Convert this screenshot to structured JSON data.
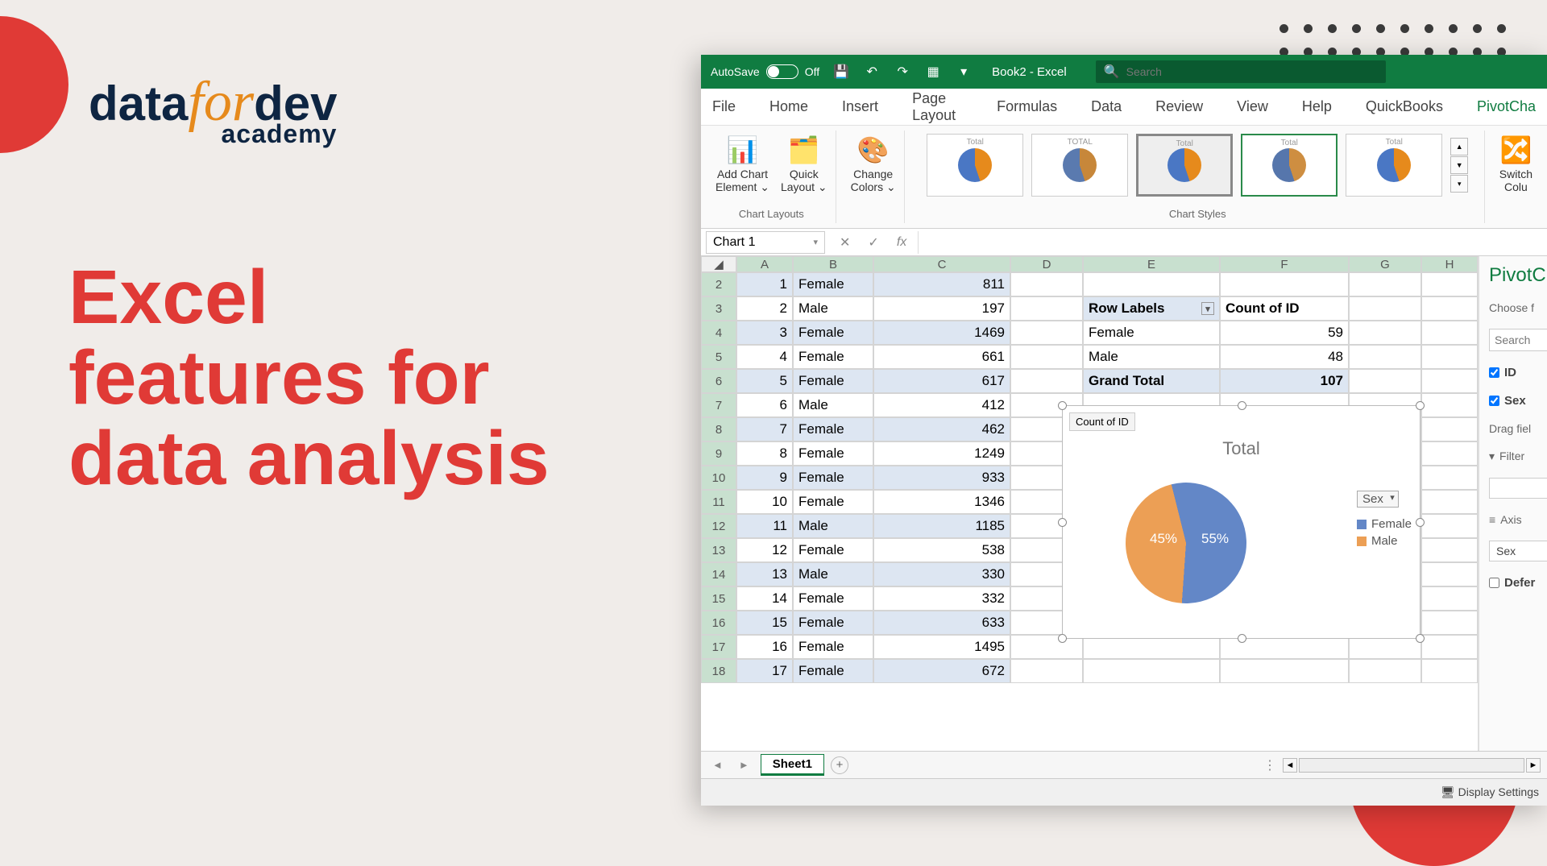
{
  "promo": {
    "logo_data": "data",
    "logo_for": "for",
    "logo_dev": "dev",
    "logo_academy": "academy",
    "headline_l1": "Excel",
    "headline_l2": "features for",
    "headline_l3": "data analysis"
  },
  "titlebar": {
    "autosave": "AutoSave",
    "autosave_state": "Off",
    "doc": "Book2  -  Excel",
    "search_placeholder": "Search"
  },
  "tabs": [
    "File",
    "Home",
    "Insert",
    "Page Layout",
    "Formulas",
    "Data",
    "Review",
    "View",
    "Help",
    "QuickBooks",
    "PivotCha"
  ],
  "ribbon": {
    "group1_label": "Chart Layouts",
    "btn_add_chart_l1": "Add Chart",
    "btn_add_chart_l2": "Element ⌄",
    "btn_quick_l1": "Quick",
    "btn_quick_l2": "Layout ⌄",
    "group2_btn_l1": "Change",
    "group2_btn_l2": "Colors ⌄",
    "group2_label": "Chart Styles",
    "group3_btn_l1": "Switch",
    "group3_btn_l2": "Colu"
  },
  "namebox": "Chart 1",
  "fx_label": "fx",
  "columns": [
    "A",
    "B",
    "C",
    "D",
    "E",
    "F",
    "G",
    "H"
  ],
  "rows": [
    {
      "n": 2,
      "a": 1,
      "b": "Female",
      "c": 811
    },
    {
      "n": 3,
      "a": 2,
      "b": "Male",
      "c": 197
    },
    {
      "n": 4,
      "a": 3,
      "b": "Female",
      "c": 1469
    },
    {
      "n": 5,
      "a": 4,
      "b": "Female",
      "c": 661
    },
    {
      "n": 6,
      "a": 5,
      "b": "Female",
      "c": 617
    },
    {
      "n": 7,
      "a": 6,
      "b": "Male",
      "c": 412
    },
    {
      "n": 8,
      "a": 7,
      "b": "Female",
      "c": 462
    },
    {
      "n": 9,
      "a": 8,
      "b": "Female",
      "c": 1249
    },
    {
      "n": 10,
      "a": 9,
      "b": "Female",
      "c": 933
    },
    {
      "n": 11,
      "a": 10,
      "b": "Female",
      "c": 1346
    },
    {
      "n": 12,
      "a": 11,
      "b": "Male",
      "c": 1185
    },
    {
      "n": 13,
      "a": 12,
      "b": "Female",
      "c": 538
    },
    {
      "n": 14,
      "a": 13,
      "b": "Male",
      "c": 330
    },
    {
      "n": 15,
      "a": 14,
      "b": "Female",
      "c": 332
    },
    {
      "n": 16,
      "a": 15,
      "b": "Female",
      "c": 633
    },
    {
      "n": 17,
      "a": 16,
      "b": "Female",
      "c": 1495
    },
    {
      "n": 18,
      "a": 17,
      "b": "Female",
      "c": 672
    }
  ],
  "pivot": {
    "row_labels": "Row Labels",
    "count_of_id": "Count of ID",
    "female": "Female",
    "female_n": 59,
    "male": "Male",
    "male_n": 48,
    "grand": "Grand Total",
    "grand_n": 107
  },
  "chart_data": {
    "type": "pie",
    "title": "Total",
    "button": "Count of ID",
    "legend_field": "Sex",
    "series": [
      {
        "name": "Female",
        "percent": 55,
        "color": "#6387c7"
      },
      {
        "name": "Male",
        "percent": 45,
        "color": "#ec9f55"
      }
    ],
    "pct_female": "55%",
    "pct_male": "45%"
  },
  "sheet_tab": "Sheet1",
  "statusbar": {
    "display_settings": "Display Settings"
  },
  "pane": {
    "title": "PivotC",
    "choose": "Choose f",
    "search": "Search",
    "field_id": "ID",
    "field_sex": "Sex",
    "drag": "Drag fiel",
    "filters": "Filter",
    "axis": "Axis",
    "axis_val": "Sex",
    "defer": "Defer"
  }
}
